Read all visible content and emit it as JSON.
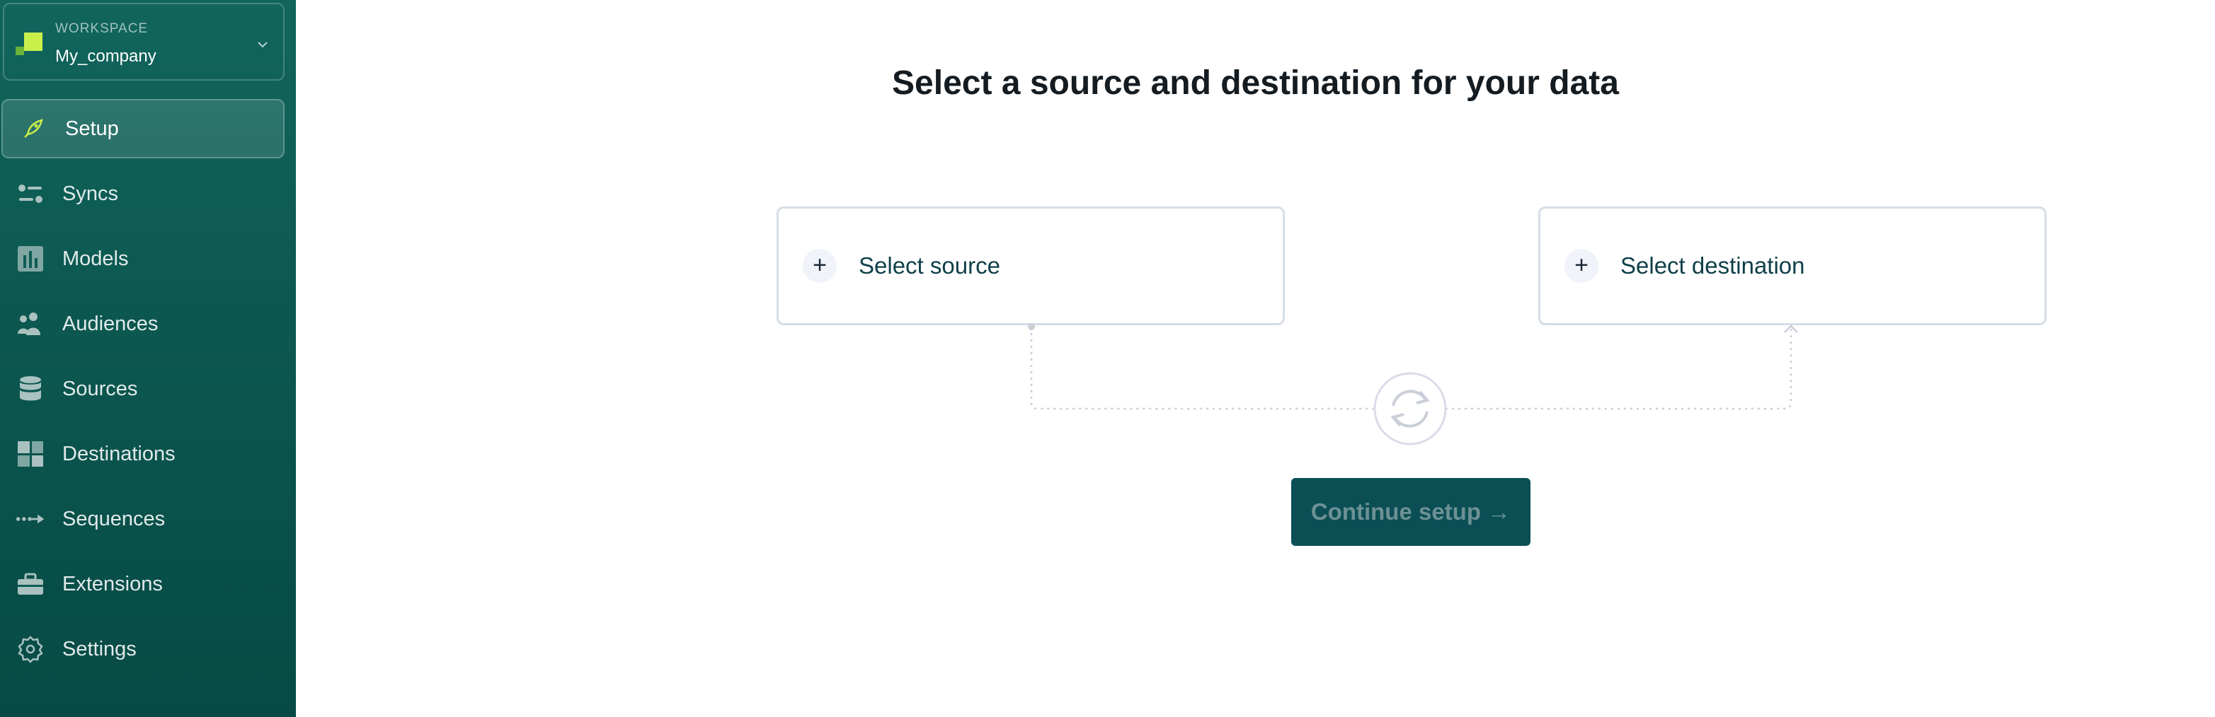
{
  "workspace": {
    "caption": "WORKSPACE",
    "name": "My_company",
    "logo_colors": [
      "#c9ef4b",
      "#6bb33b"
    ]
  },
  "sidebar": {
    "active_item": "Setup",
    "items": [
      {
        "label": "Setup",
        "icon": "rocket-icon"
      },
      {
        "label": "Syncs",
        "icon": "sliders-icon"
      },
      {
        "label": "Models",
        "icon": "bar-chart-icon"
      },
      {
        "label": "Audiences",
        "icon": "people-icon"
      },
      {
        "label": "Sources",
        "icon": "database-icon"
      },
      {
        "label": "Destinations",
        "icon": "grid-icon"
      },
      {
        "label": "Sequences",
        "icon": "sequence-arrow-icon"
      },
      {
        "label": "Extensions",
        "icon": "toolbox-icon"
      },
      {
        "label": "Settings",
        "icon": "gear-icon"
      }
    ]
  },
  "main": {
    "title": "Select a source and destination for your data",
    "source_card": {
      "plus": "+",
      "label": "Select source"
    },
    "destination_card": {
      "plus": "+",
      "label": "Select destination"
    },
    "sync_icon": "sync-icon",
    "continue_label": "Continue setup →"
  },
  "colors": {
    "sidebar_top": "#11655c",
    "sidebar_bottom": "#074a45",
    "accent": "#0b4f55",
    "card_border": "#d6dde6",
    "title_text": "#141c22"
  }
}
